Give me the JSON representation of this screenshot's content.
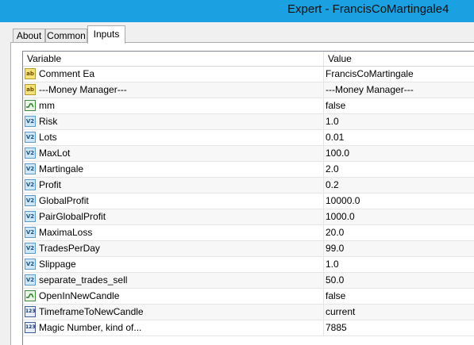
{
  "window": {
    "title": "Expert - FrancisCoMartingale4"
  },
  "tabs": [
    {
      "label": "About"
    },
    {
      "label": "Common"
    },
    {
      "label": "Inputs"
    }
  ],
  "table": {
    "headers": {
      "variable": "Variable",
      "value": "Value"
    },
    "rows": [
      {
        "icon": "ab",
        "variable": "Comment Ea",
        "value": "FrancisCoMartingale"
      },
      {
        "icon": "ab",
        "variable": "---Money Manager---",
        "value": "---Money Manager---"
      },
      {
        "icon": "bool",
        "variable": "mm",
        "value": "false"
      },
      {
        "icon": "num",
        "variable": "Risk",
        "value": "1.0"
      },
      {
        "icon": "num",
        "variable": "Lots",
        "value": "0.01"
      },
      {
        "icon": "num",
        "variable": "MaxLot",
        "value": "100.0"
      },
      {
        "icon": "num",
        "variable": "Martingale",
        "value": "2.0"
      },
      {
        "icon": "num",
        "variable": "Profit",
        "value": "0.2"
      },
      {
        "icon": "num",
        "variable": "GlobalProfit",
        "value": "10000.0"
      },
      {
        "icon": "num",
        "variable": "PairGlobalProfit",
        "value": "1000.0"
      },
      {
        "icon": "num",
        "variable": "MaximaLoss",
        "value": "20.0"
      },
      {
        "icon": "num",
        "variable": "TradesPerDay",
        "value": "99.0"
      },
      {
        "icon": "num",
        "variable": "Slippage",
        "value": "1.0"
      },
      {
        "icon": "num",
        "variable": "separate_trades_sell",
        "value": "50.0"
      },
      {
        "icon": "bool",
        "variable": "OpenInNewCandle",
        "value": "false"
      },
      {
        "icon": "int",
        "variable": "TimeframeToNewCandle",
        "value": "current"
      },
      {
        "icon": "int",
        "variable": "Magic Number, kind of...",
        "value": "7885"
      }
    ]
  },
  "icons": {
    "ab": "ab",
    "num": "V2",
    "int": "123"
  },
  "colors": {
    "titlebar": "#1ba1e2",
    "row_shaded": "#f7f7f7"
  }
}
